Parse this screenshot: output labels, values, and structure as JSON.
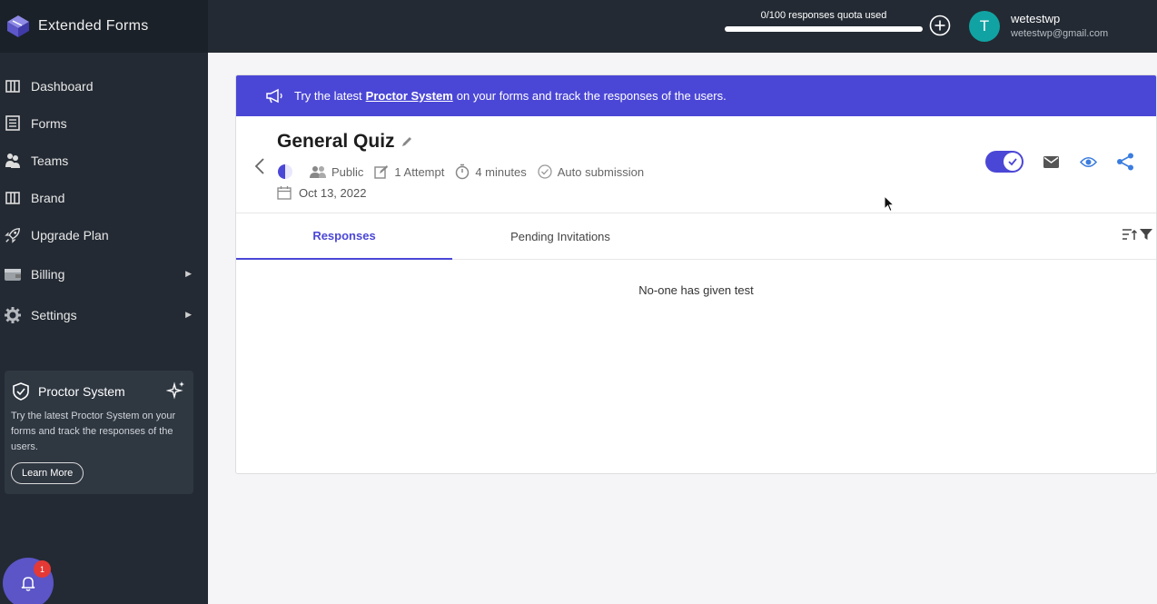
{
  "app": {
    "name": "Extended Forms"
  },
  "sidebar": {
    "items": [
      {
        "label": "Dashboard",
        "icon": "columns-icon"
      },
      {
        "label": "Forms",
        "icon": "list-icon"
      },
      {
        "label": "Teams",
        "icon": "people-icon"
      },
      {
        "label": "Brand",
        "icon": "columns-icon"
      },
      {
        "label": "Upgrade Plan",
        "icon": "rocket-icon"
      },
      {
        "label": "Billing",
        "icon": "wallet-icon"
      },
      {
        "label": "Settings",
        "icon": "gear-icon"
      }
    ],
    "promo": {
      "title": "Proctor System",
      "text": "Try the latest Proctor System on your forms and track the responses of the users.",
      "button": "Learn More"
    },
    "notifications": {
      "count": "1"
    }
  },
  "topbar": {
    "quota_text": "0/100 responses quota used",
    "quota_fraction": 0,
    "avatar_letter": "T",
    "user_name": "wetestwp",
    "user_email": "wetestwp@gmail.com"
  },
  "banner": {
    "prefix": "Try the latest",
    "link": "Proctor System",
    "suffix": "on your forms and track the responses of the users."
  },
  "form": {
    "title": "General Quiz",
    "visibility": "Public",
    "attempts": "1 Attempt",
    "duration": "4 minutes",
    "submission": "Auto submission",
    "date": "Oct 13, 2022",
    "published": true
  },
  "tabs": [
    {
      "label": "Responses",
      "active": true
    },
    {
      "label": "Pending Invitations",
      "active": false
    }
  ],
  "empty_message": "No-one has given test",
  "colors": {
    "accent": "#4b47d6",
    "sidebar": "#232a33",
    "avatar": "#11a3a3"
  }
}
